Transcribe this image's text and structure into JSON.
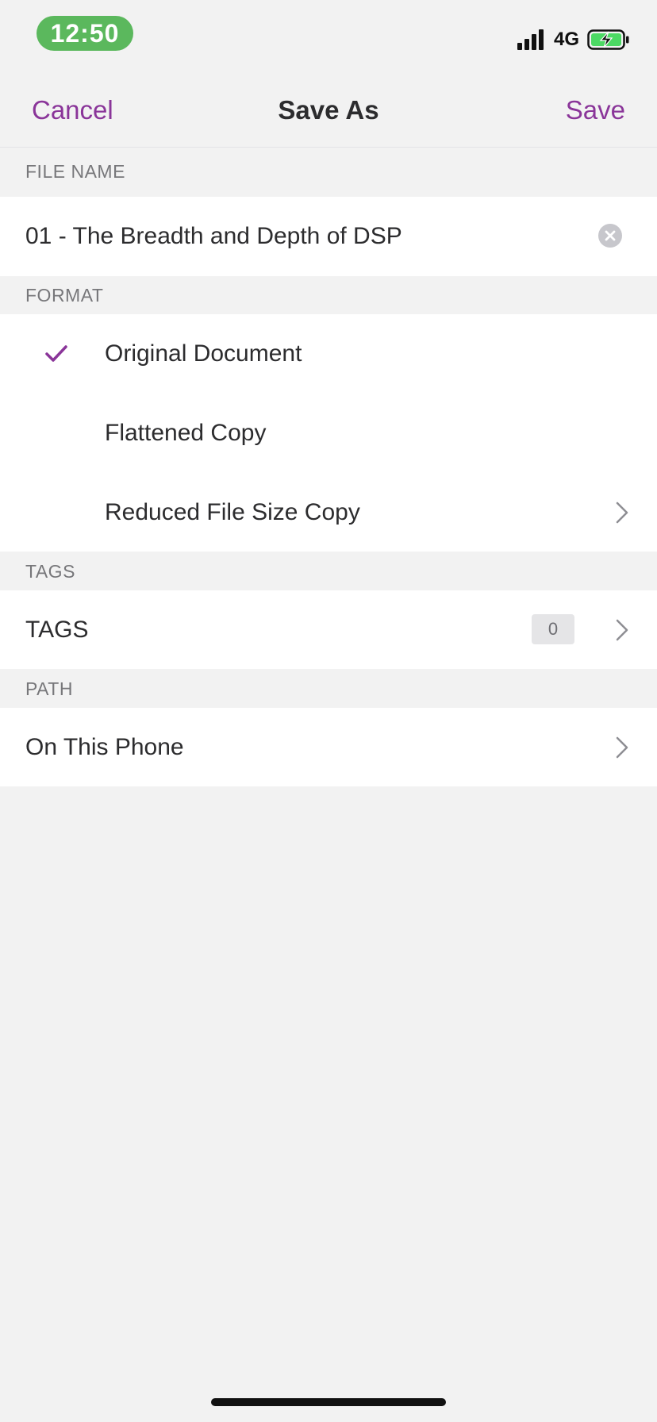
{
  "status_bar": {
    "time": "12:50",
    "network": "4G",
    "signal_icon": "signal-bars-icon",
    "battery_icon": "battery-charging-icon"
  },
  "nav": {
    "cancel_label": "Cancel",
    "title": "Save As",
    "save_label": "Save"
  },
  "file_name_section": {
    "header": "FILE NAME",
    "value": "01 - The Breadth and Depth of DSP",
    "clear_icon": "clear-circle-icon"
  },
  "format_section": {
    "header": "FORMAT",
    "options": [
      {
        "label": "Original Document",
        "selected": true
      },
      {
        "label": "Flattened Copy",
        "selected": false
      },
      {
        "label": "Reduced File Size Copy",
        "selected": false,
        "has_chevron": true
      }
    ]
  },
  "tags_section": {
    "header": "TAGS",
    "row_label": "TAGS",
    "count": "0"
  },
  "path_section": {
    "header": "PATH",
    "row_label": "On This Phone"
  },
  "colors": {
    "accent": "#8a3599",
    "time_pill": "#5bb85d",
    "background": "#f2f2f2"
  }
}
